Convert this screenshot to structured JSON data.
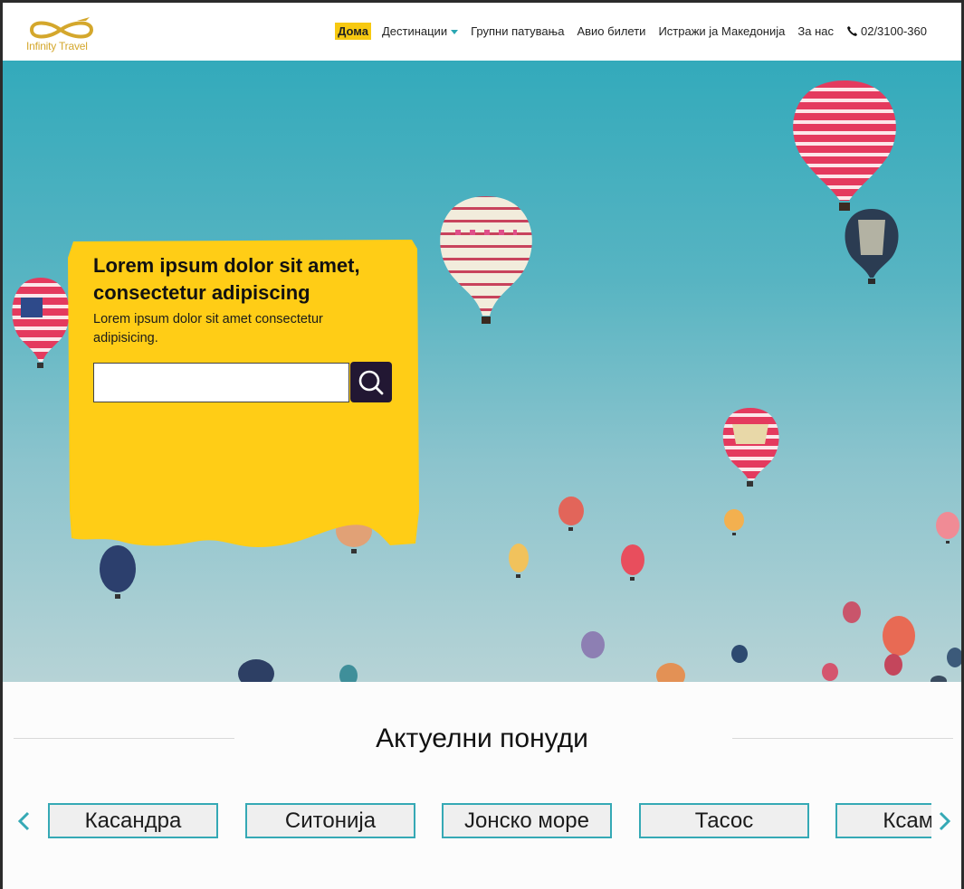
{
  "brand": {
    "logo_text": "Infinity Travel",
    "color": "#d4a72c"
  },
  "nav": {
    "items": [
      {
        "label": "Дома",
        "active": true
      },
      {
        "label": "Дестинации",
        "dropdown": true
      },
      {
        "label": "Групни патувања"
      },
      {
        "label": "Авио билети"
      },
      {
        "label": "Истражи ја Македонија"
      },
      {
        "label": "За нас"
      }
    ],
    "phone": "02/3100-360",
    "phone_icon": "phone-icon",
    "accent": "#f7c911"
  },
  "hero": {
    "title": "Lorem ipsum dolor sit amet, consectetur adipiscing",
    "subtitle": "Lorem ipsum dolor sit amet consectetur adipisicing.",
    "search": {
      "value": "",
      "placeholder": "",
      "icon": "search-icon"
    },
    "panel_color": "#ffcd16"
  },
  "offers": {
    "title": "Актуелни понуди",
    "items": [
      "Касандра",
      "Ситонија",
      "Јонско море",
      "Тасос",
      "Ксамил"
    ],
    "prev_icon": "chevron-left-icon",
    "next_icon": "chevron-right-icon",
    "accent": "#35a9b5"
  }
}
